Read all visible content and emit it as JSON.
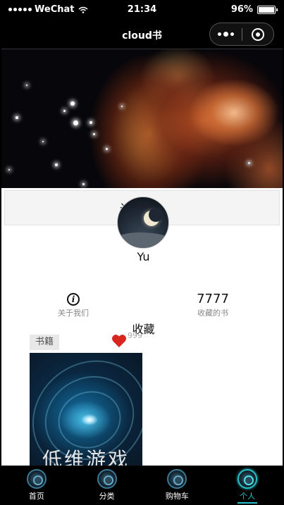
{
  "status_bar": {
    "carrier": "WeChat",
    "time": "21:34",
    "battery": "96%",
    "battery_level": 0.96
  },
  "nav": {
    "title": "cloud书"
  },
  "login": {
    "label": "请登录"
  },
  "profile": {
    "username": "Yu"
  },
  "stats": {
    "about_label": "关于我们",
    "fav_count": "7777",
    "fav_label": "收藏的书"
  },
  "favorites": {
    "section_title": "收藏",
    "tag": "书籍",
    "like_count": "999",
    "book_title": "低维游戏"
  },
  "tabbar": {
    "items": [
      {
        "label": "首页",
        "active": false
      },
      {
        "label": "分类",
        "active": false
      },
      {
        "label": "购物车",
        "active": false
      },
      {
        "label": "个人",
        "active": true
      }
    ]
  },
  "colors": {
    "accent": "#2ac0c8",
    "heart": "#d9261c"
  }
}
